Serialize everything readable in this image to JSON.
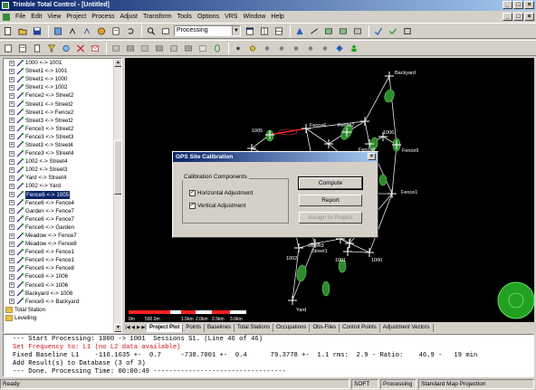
{
  "window": {
    "title": "Trimble Total Control - [Untitled]",
    "controls": [
      "_",
      "□",
      "×"
    ]
  },
  "menu": [
    "File",
    "Edit",
    "View",
    "Project",
    "Process",
    "Adjust",
    "Transform",
    "Tools",
    "Options",
    "VRS",
    "Window",
    "Help"
  ],
  "toolbar": {
    "mode_combo": "Processing"
  },
  "tree": {
    "items": [
      {
        "label": "1000 <-> 1001",
        "selected": false
      },
      {
        "label": "Street1 <-> 1001",
        "selected": false
      },
      {
        "label": "Street1 <-> 1000",
        "selected": false
      },
      {
        "label": "Street1 <-> 1002",
        "selected": false
      },
      {
        "label": "Fence2 <-> Street2",
        "selected": false
      },
      {
        "label": "Street1 <-> Street2",
        "selected": false
      },
      {
        "label": "Street1 <-> Fence2",
        "selected": false
      },
      {
        "label": "Street3 <-> Street2",
        "selected": false
      },
      {
        "label": "Fence3 <-> Street2",
        "selected": false
      },
      {
        "label": "Fence3 <-> Street3",
        "selected": false
      },
      {
        "label": "Street3 <-> Street4",
        "selected": false
      },
      {
        "label": "Fence3 <-> Street4",
        "selected": false
      },
      {
        "label": "1002 <-> Street4",
        "selected": false
      },
      {
        "label": "1002 <-> Street3",
        "selected": false
      },
      {
        "label": "Yard <-> Street4",
        "selected": false
      },
      {
        "label": "1002 <-> Yard",
        "selected": false
      },
      {
        "label": "Fence6 <-> 1005",
        "selected": true
      },
      {
        "label": "Fence6 <-> Fence4",
        "selected": false
      },
      {
        "label": "Garden <-> Fence7",
        "selected": false
      },
      {
        "label": "Fence6 <-> Fence7",
        "selected": false
      },
      {
        "label": "Fence6 <-> Garden",
        "selected": false
      },
      {
        "label": "Meadow <-> Fence7",
        "selected": false
      },
      {
        "label": "Meadow <-> Fence8",
        "selected": false
      },
      {
        "label": "Fence8 <-> Fence1",
        "selected": false
      },
      {
        "label": "Fence9 <-> Fence1",
        "selected": false
      },
      {
        "label": "Fence9 <-> Fence8",
        "selected": false
      },
      {
        "label": "Fence8 <-> 1006",
        "selected": false
      },
      {
        "label": "Fence9 <-> 1006",
        "selected": false
      },
      {
        "label": "Backyard <-> 1006",
        "selected": false
      },
      {
        "label": "Fence9 <-> Backyard",
        "selected": false
      }
    ],
    "footer_items": [
      "Total Station",
      "Levelling"
    ]
  },
  "plot": {
    "point_labels": [
      "Backyard",
      "1005",
      "Fence6",
      "Fence7",
      "Fence8",
      "1006",
      "Fence9",
      "Fence1",
      "Street3",
      "Street2",
      "Street1",
      "1002",
      "1001",
      "1000",
      "Yard"
    ],
    "scale_labels": [
      "0m",
      "500.0m",
      "1.5km",
      "2.0km",
      "2.5km",
      "3.0km"
    ]
  },
  "tabs": [
    "Project Plot",
    "Points",
    "Baselines",
    "Total Stations",
    "Occupations",
    "Obs-Files",
    "Control Points",
    "Adjustment Vectors"
  ],
  "output": {
    "lines": [
      {
        "text": "--- Start Processing: 1000 -> 1001  Sessions S1. (Line 46 of 46)",
        "red": false
      },
      {
        "text": "Set Frequency to: L1 (no L2 data available)",
        "red": true
      },
      {
        "text": "Fixed Baseline L1    -116.1635 +-  0.7     -738.7001 +-  0.4      79.3778 +-  1.1 rms:  2.9 - Ratio:    46.9 -   19 min",
        "red": false
      },
      {
        "text": "Add Result(s) to Database (3 of 3)",
        "red": false
      },
      {
        "text": "--- Done. Processing Time: 00:00:49 ----------------------------------",
        "red": false
      }
    ]
  },
  "status": [
    "Ready",
    "SOFT",
    "Processing",
    "Standard Map Projection"
  ],
  "dialog": {
    "title": "GPS Site Calibration",
    "group_label": "Calibration Components",
    "checkbox1": "Horizontal Adjustment",
    "checkbox2": "Vertical Adjustment",
    "compute": "Compute",
    "report": "Report",
    "assign": "Assign to Project"
  }
}
